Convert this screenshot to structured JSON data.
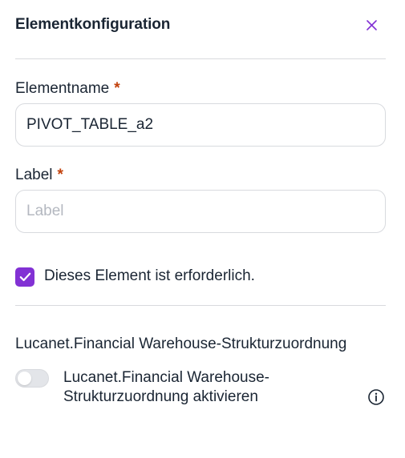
{
  "header": {
    "title": "Elementkonfiguration",
    "close_icon": "close-icon",
    "accent_color": "#8231d4"
  },
  "form": {
    "element_name": {
      "label": "Elementname",
      "required_marker": "*",
      "value": "PIVOT_TABLE_a2"
    },
    "label_field": {
      "label": "Label",
      "required_marker": "*",
      "value": "",
      "placeholder": "Label"
    },
    "required_checkbox": {
      "checked": true,
      "label": "Dieses Element ist erforderlich."
    }
  },
  "mapping": {
    "section_title": "Lucanet.Financial Warehouse-Strukturzuordnung",
    "toggle": {
      "enabled": false,
      "label": "Lucanet.Financial Warehouse-Strukturzuordnung aktivieren"
    },
    "info_icon": "info-icon"
  }
}
